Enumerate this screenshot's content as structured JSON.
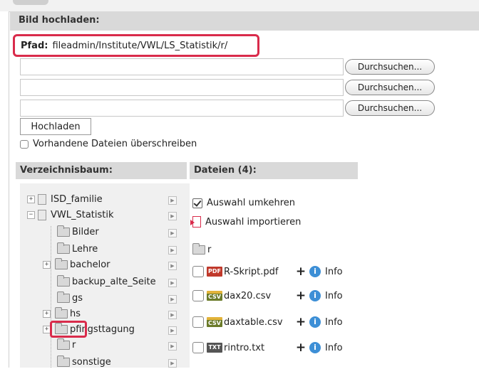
{
  "panel": {
    "title": "Bild hochladen:"
  },
  "path": {
    "label": "Pfad:",
    "value": "fileadmin/Institute/VWL/LS_Statistik/r/"
  },
  "upload": {
    "inputs": [
      {
        "value": ""
      },
      {
        "value": ""
      },
      {
        "value": ""
      }
    ],
    "browse_label": "Durchsuchen...",
    "upload_button": "Hochladen",
    "overwrite_label": "Vorhandene Dateien überschreiben",
    "overwrite_checked": false
  },
  "tree": {
    "heading": "Verzeichnisbaum:",
    "items": [
      {
        "label": "ISD_familie",
        "expander": "+"
      },
      {
        "label": "VWL_Statistik",
        "expander": "−"
      },
      {
        "label": "Bilder",
        "expander": ""
      },
      {
        "label": "Lehre",
        "expander": ""
      },
      {
        "label": "bachelor",
        "expander": "+"
      },
      {
        "label": "backup_alte_Seite",
        "expander": ""
      },
      {
        "label": "gs",
        "expander": ""
      },
      {
        "label": "hs",
        "expander": "+"
      },
      {
        "label": "pfingsttagung",
        "expander": "+"
      },
      {
        "label": "r",
        "expander": "",
        "selected": true
      },
      {
        "label": "sonstige",
        "expander": ""
      }
    ],
    "selected_color": "#d92b4b"
  },
  "files": {
    "heading": "Dateien (4):",
    "invert_selection": "Auswahl umkehren",
    "import_selection": "Auswahl importieren",
    "current_folder": "r",
    "items": [
      {
        "name": "R-Skript.pdf",
        "type": "PDF",
        "plus": "+",
        "info": "Info"
      },
      {
        "name": "dax20.csv",
        "type": "CSV",
        "plus": "+",
        "info": "Info"
      },
      {
        "name": "daxtable.csv",
        "type": "CSV",
        "plus": "+",
        "info": "Info"
      },
      {
        "name": "rintro.txt",
        "type": "TXT",
        "plus": "+",
        "info": "Info"
      }
    ],
    "info_icon_glyph": "i"
  },
  "colors": {
    "highlight": "#d92b4b",
    "section_bg": "#d9d9d9",
    "info_blue": "#3d8fd6"
  }
}
